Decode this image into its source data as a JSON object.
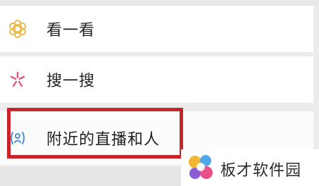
{
  "menu": {
    "items": [
      {
        "label": "看一看",
        "icon": "look-star-icon",
        "icon_color": "#e9b94a"
      },
      {
        "label": "搜一搜",
        "icon": "search-spark-icon",
        "icon_color": "#e05a7a"
      },
      {
        "label": "附近的直播和人",
        "icon": "nearby-people-icon",
        "icon_color": "#4a90d9"
      }
    ],
    "highlight_color": "#c8242a"
  },
  "watermark": {
    "text": "板才软件园",
    "logo_icon": "colorful-bubbles-logo-icon"
  }
}
